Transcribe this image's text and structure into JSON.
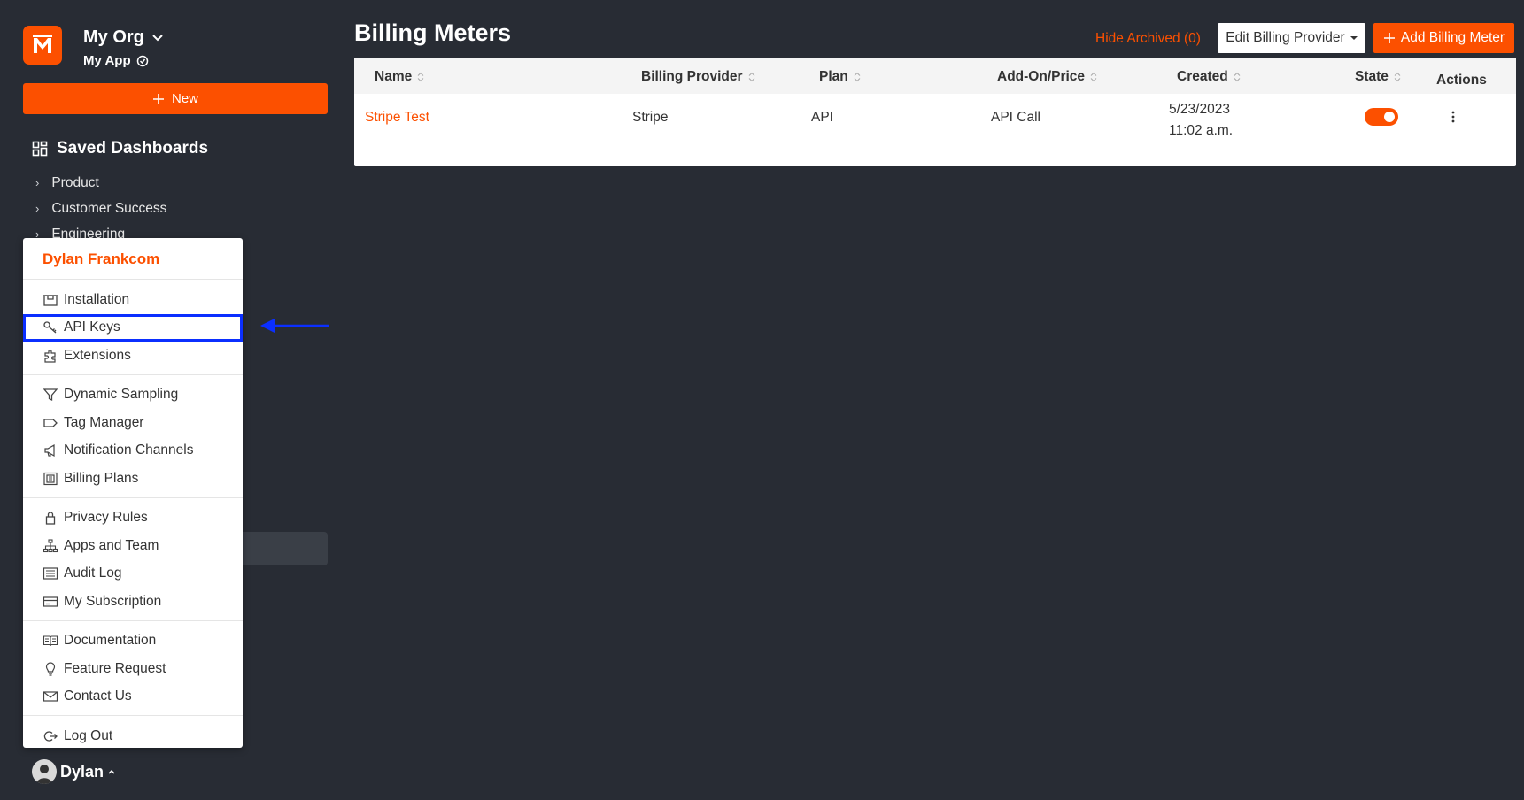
{
  "sidebar": {
    "org_name": "My Org",
    "app_name": "My App",
    "new_label": "New",
    "dashboards_title": "Saved Dashboards",
    "dashboards": [
      {
        "label": "Product"
      },
      {
        "label": "Customer Success"
      },
      {
        "label": "Engineering"
      }
    ],
    "user_name": "Dylan"
  },
  "menu": {
    "user": "Dylan Frankcom",
    "sections": [
      [
        {
          "label": "Installation",
          "icon": "installation-icon"
        },
        {
          "label": "API Keys",
          "icon": "key-icon"
        },
        {
          "label": "Extensions",
          "icon": "puzzle-icon"
        }
      ],
      [
        {
          "label": "Dynamic Sampling",
          "icon": "filter-icon"
        },
        {
          "label": "Tag Manager",
          "icon": "tag-icon"
        },
        {
          "label": "Notification Channels",
          "icon": "megaphone-icon"
        },
        {
          "label": "Billing Plans",
          "icon": "billing-plans-icon"
        }
      ],
      [
        {
          "label": "Privacy Rules",
          "icon": "lock-icon"
        },
        {
          "label": "Apps and Team",
          "icon": "org-chart-icon"
        },
        {
          "label": "Audit Log",
          "icon": "list-icon"
        },
        {
          "label": "My Subscription",
          "icon": "card-icon"
        }
      ],
      [
        {
          "label": "Documentation",
          "icon": "book-icon"
        },
        {
          "label": "Feature Request",
          "icon": "lightbulb-icon"
        },
        {
          "label": "Contact Us",
          "icon": "mail-icon"
        }
      ],
      [
        {
          "label": "Log Out",
          "icon": "logout-icon"
        }
      ]
    ]
  },
  "main": {
    "title": "Billing Meters",
    "hide_archived": "Hide Archived (0)",
    "edit_provider": "Edit Billing Provider",
    "add_meter": "Add Billing Meter",
    "columns": {
      "name": "Name",
      "provider": "Billing Provider",
      "plan": "Plan",
      "addon": "Add-On/Price",
      "created": "Created",
      "state": "State",
      "actions": "Actions"
    },
    "rows": [
      {
        "name": "Stripe Test",
        "provider": "Stripe",
        "plan": "API",
        "addon": "API Call",
        "created_date": "5/23/2023",
        "created_time": "11:02 a.m.",
        "state_on": true
      }
    ]
  },
  "colors": {
    "accent": "#fc5000",
    "background": "#282c34",
    "highlight": "#0b2fff"
  }
}
